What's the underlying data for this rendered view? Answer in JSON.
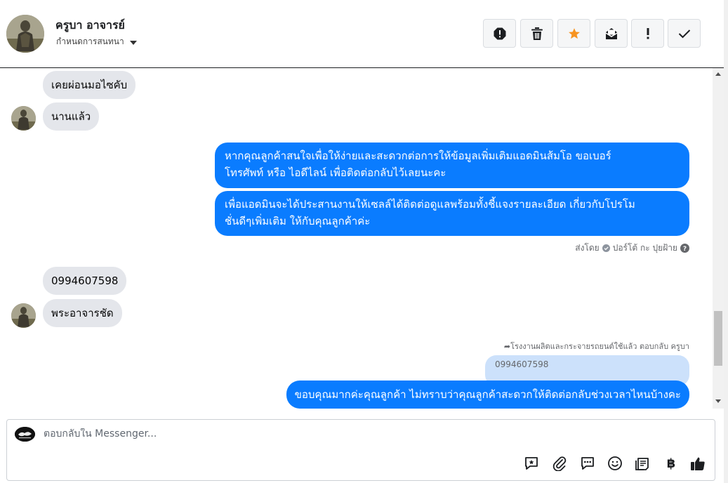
{
  "header": {
    "contact_name": "ครูบา อาจารย์",
    "assign_label": "กำหนดการสนทนา",
    "actions": [
      {
        "name": "spam-icon",
        "label": "spam"
      },
      {
        "name": "trash-icon",
        "label": "delete"
      },
      {
        "name": "star-icon",
        "label": "star",
        "color": "#f79420"
      },
      {
        "name": "mark-unread-icon",
        "label": "unread"
      },
      {
        "name": "important-icon",
        "label": "important"
      },
      {
        "name": "done-icon",
        "label": "done"
      }
    ]
  },
  "messages": {
    "m1": "เคยผ่อนมอไซคับ",
    "m2": "นานแล้ว",
    "m3_line1": "หากคุณลูกค้าสนใจเพื่อให้ง่ายและสะดวกต่อการให้ข้อมูลเพิ่มเติมแอดมินส้มโอ ขอเบอร์",
    "m3_line2": "โทรศัพท์ หรือ ไอดีไลน์ เพื่อติดต่อกลับไว้เลยนะคะ",
    "m4_line1": "เพื่อแอดมินจะได้ประสานงานให้เซลล์ได้ติดต่อดูแลพร้อมทั้งชี้แจงรายละเอียด เกี่ยวกับโปรโม",
    "m4_line2": "ชั่นดีๆเพิ่มเติม ให้กับคุณลูกค้าค่ะ",
    "sent_by_prefix": "ส่งโดย",
    "sent_by_name": "ปอร์โต้ กะ ปุยฝ้าย",
    "m5": "0994607598",
    "m6": "พระอาจารชัด",
    "reply_context": "โรงงานผลิตและกระจายรถยนต์ใช้แล้ว ตอบกลับ ครูบา",
    "quoted_text": "0994607598",
    "m7": "ขอบคุณมากค่ะคุณลูกค้า ไม่ทราบว่าคุณลูกค้าสะดวกให้ติดต่อกลับช่วงเวลาไหนบ้างคะ"
  },
  "composer": {
    "placeholder": "ตอบกลับใน Messenger...",
    "icons": [
      "saved-reply-icon",
      "attach-icon",
      "chat-icon",
      "emoji-icon",
      "notes-icon",
      "baht-icon",
      "like-icon"
    ],
    "baht_symbol": "฿"
  },
  "colors": {
    "outgoing_bubble": "#0a7cff",
    "incoming_bubble": "#e4e6eb",
    "quoted_bubble": "#cce1fb"
  }
}
